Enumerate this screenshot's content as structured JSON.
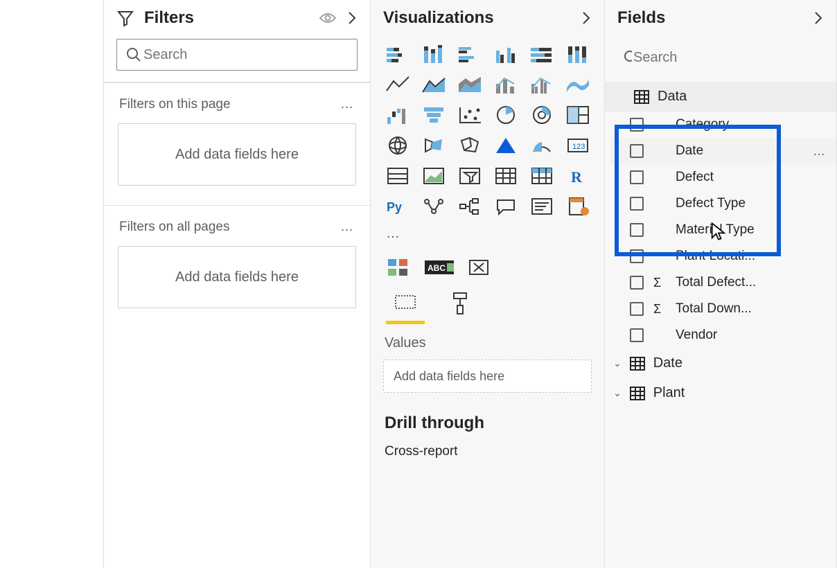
{
  "filters": {
    "title": "Filters",
    "search_placeholder": "Search",
    "on_page_label": "Filters on this page",
    "all_pages_label": "Filters on all pages",
    "drop_hint": "Add data fields here"
  },
  "viz": {
    "title": "Visualizations",
    "more": "…",
    "values_label": "Values",
    "drop_hint": "Add data fields here",
    "drill_title": "Drill through",
    "cross_report": "Cross-report"
  },
  "fields": {
    "title": "Fields",
    "search_placeholder": "Search",
    "tables": [
      {
        "name": "Data",
        "expanded": true,
        "fields": [
          {
            "name": "Category",
            "sigma": false
          },
          {
            "name": "Date",
            "sigma": false,
            "hover": true
          },
          {
            "name": "Defect",
            "sigma": false
          },
          {
            "name": "Defect Type",
            "sigma": false
          },
          {
            "name": "Material Type",
            "sigma": false
          },
          {
            "name": "Plant Locati...",
            "sigma": false
          },
          {
            "name": "Total Defect...",
            "sigma": true
          },
          {
            "name": "Total Down...",
            "sigma": true
          },
          {
            "name": "Vendor",
            "sigma": false
          }
        ]
      },
      {
        "name": "Date",
        "expanded": false
      },
      {
        "name": "Plant",
        "expanded": false
      }
    ]
  }
}
